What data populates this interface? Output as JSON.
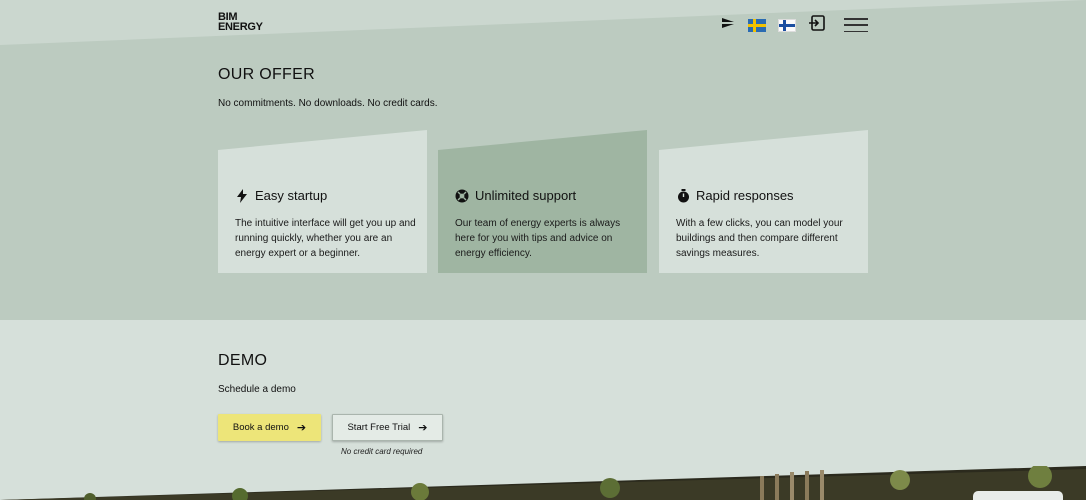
{
  "header": {
    "logo_line1": "BIM",
    "logo_line2": "ENERGY",
    "icons": [
      "lightning-logo-icon",
      "sweden-flag-icon",
      "finland-flag-icon",
      "login-icon",
      "menu-icon"
    ]
  },
  "offer": {
    "title": "OUR OFFER",
    "subtitle": "No commitments. No downloads. No credit cards.",
    "cards": [
      {
        "icon": "bolt-icon",
        "title": "Easy startup",
        "body": "The intuitive interface will get you up and running quickly, whether you are an energy expert or a beginner.",
        "color": "#d6e0da"
      },
      {
        "icon": "lifebuoy-icon",
        "title": "Unlimited support",
        "body": "Our team of energy experts is always here for you with tips and advice on energy efficiency.",
        "color": "#9fb5a2"
      },
      {
        "icon": "stopwatch-icon",
        "title": "Rapid responses",
        "body": "With a few clicks, you can model your buildings and then compare different savings measures.",
        "color": "#d6e0da"
      }
    ]
  },
  "demo": {
    "title": "DEMO",
    "subtitle": "Schedule a demo",
    "book_label": "Book a demo",
    "trial_label": "Start Free Trial",
    "note": "No credit card required"
  },
  "colors": {
    "top_bg": "#bccbc0",
    "bottom_bg": "#d6e0da",
    "accent_yellow": "#ede579",
    "card_highlight": "#9fb5a2"
  }
}
